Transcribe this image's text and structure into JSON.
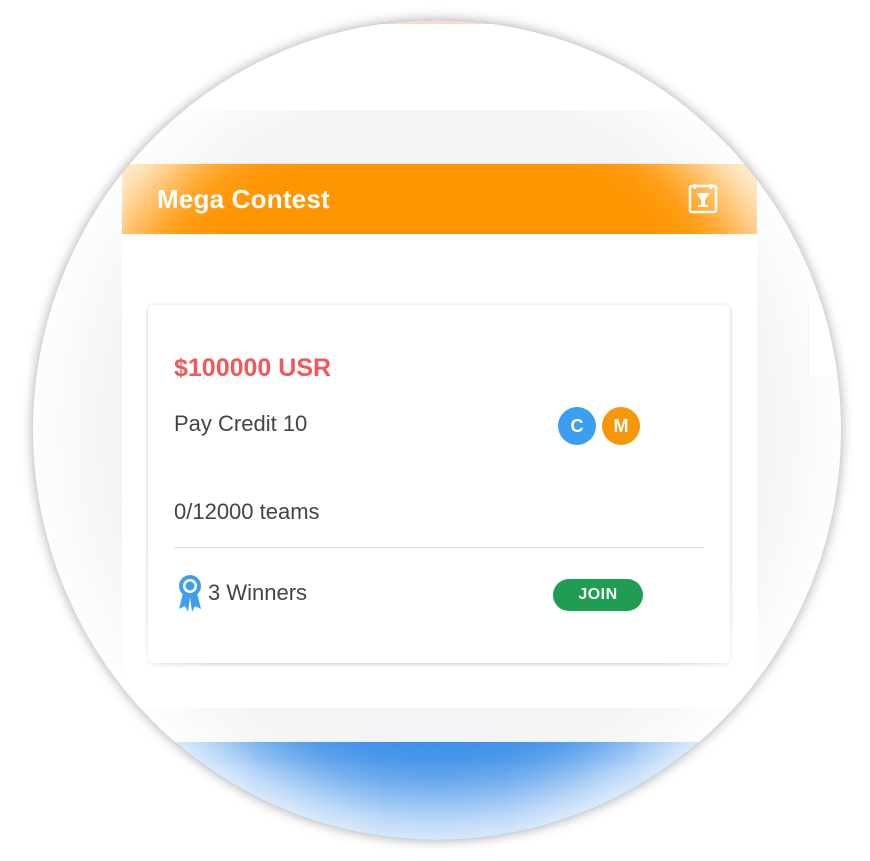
{
  "header": {
    "title": "Mega Contest",
    "icon": "trophy-ticket-icon",
    "color": "#ff9500"
  },
  "contest": {
    "prize": "$100000 USR",
    "pay_credit": "Pay Credit 10",
    "badges": [
      {
        "letter": "C",
        "color": "#3c9eef"
      },
      {
        "letter": "M",
        "color": "#f5970a"
      }
    ],
    "teams": "0/12000 teams",
    "winners": "3 Winners",
    "winners_icon": "medal-icon",
    "join_label": "JOIN",
    "join_color": "#1f9d52"
  }
}
